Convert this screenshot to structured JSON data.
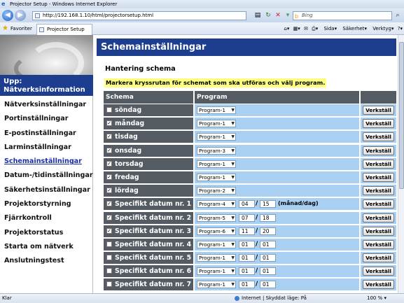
{
  "browser": {
    "title": "Projector Setup - Windows Internet Explorer",
    "url": "http://192.168.1.10/html/projectorsetup.html",
    "search_placeholder": "Bing",
    "favorites_label": "Favoriter",
    "tab_label": "Projector Setup",
    "tools": [
      "Sida",
      "Säkerhet",
      "Verktyg"
    ],
    "status_left": "Klar",
    "status_zone": "Internet | Skyddat läge: På",
    "zoom": "100 %"
  },
  "sidebar": {
    "upp_label": "Upp:\nNätverksinformation",
    "items": [
      {
        "label": "Nätverksinställningar",
        "active": false
      },
      {
        "label": "Portinställningar",
        "active": false
      },
      {
        "label": "E-postinställningar",
        "active": false
      },
      {
        "label": "Larminställningar",
        "active": false
      },
      {
        "label": "Schemainställningar",
        "active": true
      },
      {
        "label": "Datum-/tidinställningar",
        "active": false
      },
      {
        "label": "Säkerhetsinställningar",
        "active": false
      },
      {
        "label": "Projektorstyrning",
        "active": false
      },
      {
        "label": "Fjärrkontroll",
        "active": false
      },
      {
        "label": "Projektorstatus",
        "active": false
      },
      {
        "label": "Starta om nätverk",
        "active": false
      },
      {
        "label": "Anslutningstest",
        "active": false
      }
    ]
  },
  "main": {
    "header": "Schemainställningar",
    "subtitle": "Hantering schema",
    "hint": "Markera kryssrutan för schemat som ska utföras och välj program.",
    "col_schema": "Schema",
    "col_program": "Program",
    "apply_label": "Verkställ",
    "date_format": "(månad/dag)",
    "rows": [
      {
        "name": "söndag",
        "checked": false,
        "program": "Program-1"
      },
      {
        "name": "måndag",
        "checked": true,
        "program": "Program-1"
      },
      {
        "name": "tisdag",
        "checked": true,
        "program": "Program-1"
      },
      {
        "name": "onsdag",
        "checked": true,
        "program": "Program-3"
      },
      {
        "name": "torsdag",
        "checked": true,
        "program": "Program-1"
      },
      {
        "name": "fredag",
        "checked": true,
        "program": "Program-1"
      },
      {
        "name": "lördag",
        "checked": true,
        "program": "Program-2"
      },
      {
        "name": "Specifikt datum nr. 1",
        "checked": true,
        "program": "Program-4",
        "month": "04",
        "day": "15",
        "show_format": true
      },
      {
        "name": "Specifikt datum nr. 2",
        "checked": true,
        "program": "Program-5",
        "month": "07",
        "day": "18"
      },
      {
        "name": "Specifikt datum nr. 3",
        "checked": true,
        "program": "Program-6",
        "month": "11",
        "day": "20"
      },
      {
        "name": "Specifikt datum nr. 4",
        "checked": false,
        "program": "Program-1",
        "month": "01",
        "day": "01"
      },
      {
        "name": "Specifikt datum nr. 5",
        "checked": false,
        "program": "Program-1",
        "month": "01",
        "day": "01"
      },
      {
        "name": "Specifikt datum nr. 6",
        "checked": false,
        "program": "Program-1",
        "month": "01",
        "day": "01"
      },
      {
        "name": "Specifikt datum nr. 7",
        "checked": false,
        "program": "Program-1",
        "month": "01",
        "day": "01"
      }
    ]
  }
}
